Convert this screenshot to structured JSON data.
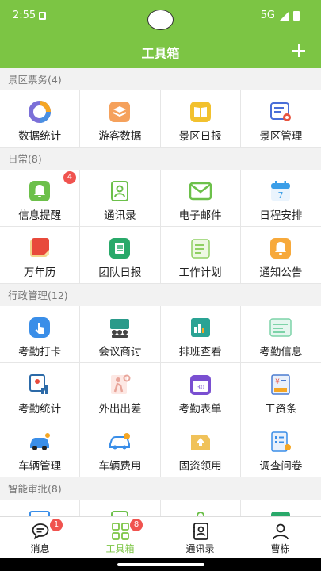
{
  "status_bar": {
    "time": "2:55",
    "network": "5G"
  },
  "header": {
    "title": "工具箱"
  },
  "sections": [
    {
      "title": "景区票务(4)",
      "items": [
        {
          "label": "数据统计",
          "icon": "pie-chart-icon"
        },
        {
          "label": "游客数据",
          "icon": "layers-icon"
        },
        {
          "label": "景区日报",
          "icon": "book-icon"
        },
        {
          "label": "景区管理",
          "icon": "settings-list-icon"
        }
      ]
    },
    {
      "title": "日常(8)",
      "items": [
        {
          "label": "信息提醒",
          "icon": "bell-icon",
          "badge": "4"
        },
        {
          "label": "通讯录",
          "icon": "contact-card-icon"
        },
        {
          "label": "电子邮件",
          "icon": "mail-icon"
        },
        {
          "label": "日程安排",
          "icon": "calendar-icon"
        },
        {
          "label": "万年历",
          "icon": "almanac-icon"
        },
        {
          "label": "团队日报",
          "icon": "document-icon"
        },
        {
          "label": "工作计划",
          "icon": "plan-icon"
        },
        {
          "label": "通知公告",
          "icon": "notice-bell-icon"
        }
      ]
    },
    {
      "title": "行政管理(12)",
      "items": [
        {
          "label": "考勤打卡",
          "icon": "tap-icon"
        },
        {
          "label": "会议商讨",
          "icon": "meeting-icon"
        },
        {
          "label": "排班查看",
          "icon": "schedule-icon"
        },
        {
          "label": "考勤信息",
          "icon": "attendance-info-icon"
        },
        {
          "label": "考勤统计",
          "icon": "attendance-stats-icon"
        },
        {
          "label": "外出出差",
          "icon": "travel-icon"
        },
        {
          "label": "考勤表单",
          "icon": "form-calendar-icon"
        },
        {
          "label": "工资条",
          "icon": "salary-icon"
        },
        {
          "label": "车辆管理",
          "icon": "car-icon"
        },
        {
          "label": "车辆费用",
          "icon": "car-cost-icon"
        },
        {
          "label": "固资领用",
          "icon": "asset-icon"
        },
        {
          "label": "调查问卷",
          "icon": "survey-icon"
        }
      ]
    },
    {
      "title": "智能审批(8)",
      "items": []
    }
  ],
  "tabs": [
    {
      "label": "消息",
      "icon": "message-icon",
      "badge": "1"
    },
    {
      "label": "工具箱",
      "icon": "grid-icon",
      "badge": "8",
      "active": true
    },
    {
      "label": "通讯录",
      "icon": "contacts-icon"
    },
    {
      "label": "曹栋",
      "icon": "person-icon"
    }
  ],
  "colors": {
    "primary": "#7cc544",
    "badge": "#f0534f",
    "label_gray": "#777777"
  }
}
